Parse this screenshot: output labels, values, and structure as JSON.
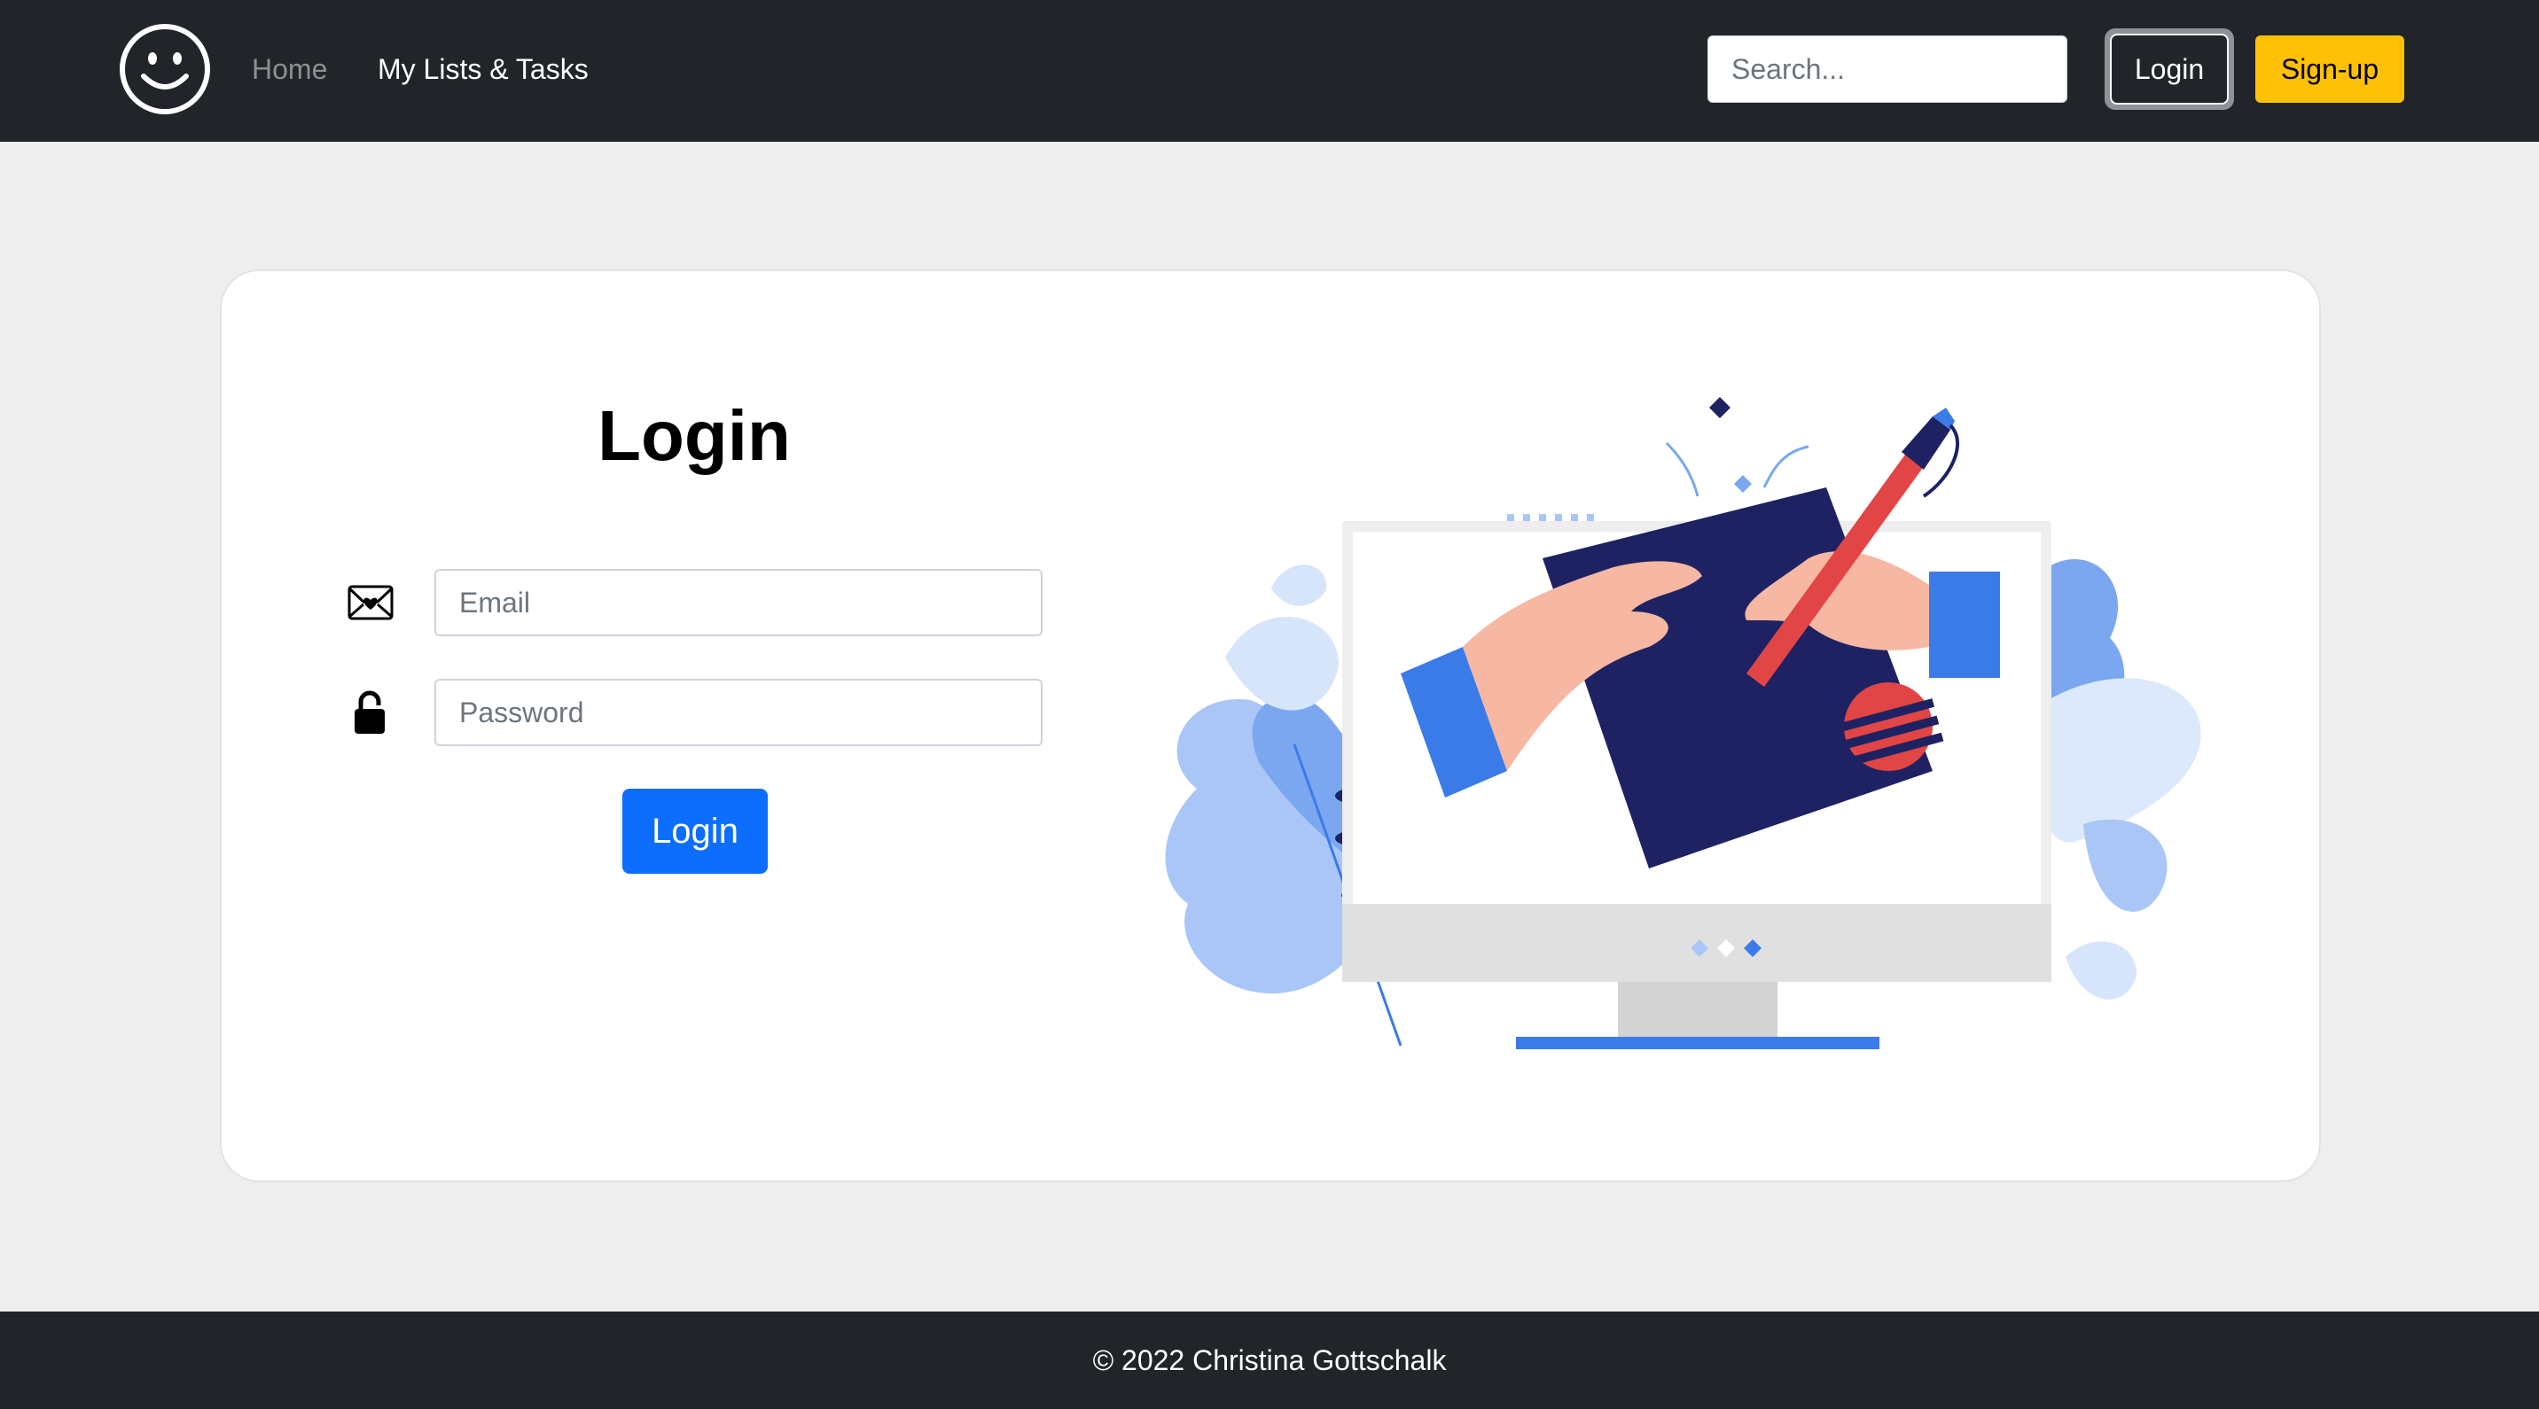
{
  "navbar": {
    "brand_icon": "smiley-face-icon",
    "links": [
      {
        "label": "Home"
      },
      {
        "label": "My Lists & Tasks"
      }
    ],
    "search": {
      "placeholder": "Search...",
      "value": ""
    },
    "login_label": "Login",
    "signup_label": "Sign-up"
  },
  "login_form": {
    "title": "Login",
    "email": {
      "placeholder": "Email",
      "value": "",
      "icon": "envelope-heart-icon"
    },
    "password": {
      "placeholder": "Password",
      "value": "",
      "icon": "lock-icon"
    },
    "submit_label": "Login"
  },
  "illustration": {
    "icon": "computer-signing-illustration"
  },
  "footer": {
    "text": "© 2022 Christina Gottschalk"
  },
  "colors": {
    "navbar_bg": "#212529",
    "page_bg": "#eeeeee",
    "primary": "#0d6efd",
    "warning": "#ffc107",
    "illustration_navy": "#1e2263",
    "illustration_blue": "#3b7be8",
    "illustration_red": "#e24545",
    "illustration_skin": "#f6b7a3"
  }
}
